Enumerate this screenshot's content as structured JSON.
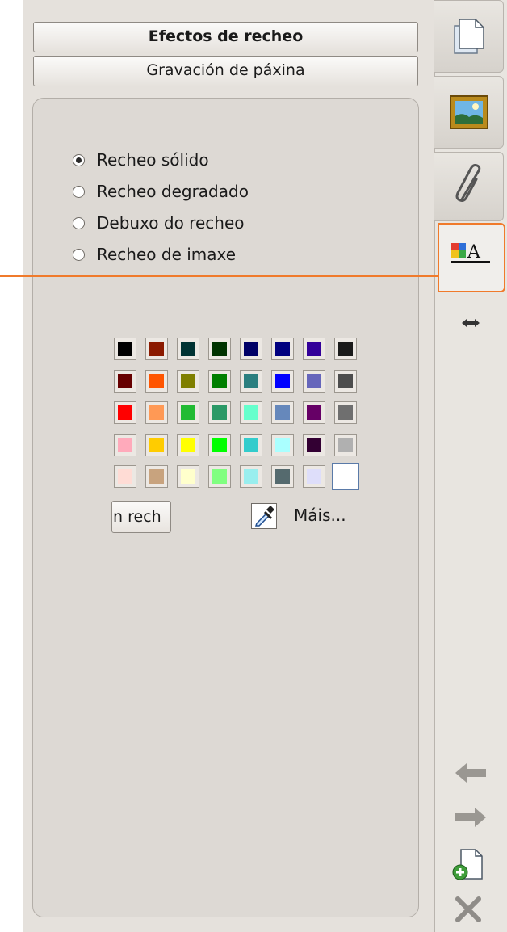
{
  "tabs_panel": {
    "title_button": "Efectos de recheo",
    "subtitle_button": "Gravación de páxina"
  },
  "fill_options": [
    {
      "label": "Recheo sólido",
      "checked": true
    },
    {
      "label": "Recheo degradado",
      "checked": false
    },
    {
      "label": "Debuxo do recheo",
      "checked": false
    },
    {
      "label": "Recheo de imaxe",
      "checked": false
    }
  ],
  "palette": {
    "rows": [
      [
        "#000000",
        "#8b1a00",
        "#003333",
        "#003300",
        "#000066",
        "#00007f",
        "#330099",
        "#1a1a1a"
      ],
      [
        "#660000",
        "#ff5500",
        "#7f7f00",
        "#007f00",
        "#2b7f7f",
        "#0000ff",
        "#6666bb",
        "#4d4d4d"
      ],
      [
        "#ff0000",
        "#ff9955",
        "#22bb33",
        "#2b9966",
        "#66ffcc",
        "#6688bb",
        "#660066",
        "#6f6f6f"
      ],
      [
        "#ffaabb",
        "#ffcc00",
        "#ffff00",
        "#00ff00",
        "#33cccc",
        "#aaffff",
        "#330033",
        "#b0b0b0"
      ],
      [
        "#ffdcd5",
        "#c8a37e",
        "#ffffcc",
        "#80ff80",
        "#99eeee",
        "#556a6e",
        "#dedefa",
        "#ffffff"
      ]
    ],
    "selected": "#ffffff"
  },
  "buttons": {
    "no_fill": "n rech",
    "more": "Máis..."
  },
  "sidebar": {
    "tabs": [
      {
        "name": "pages-tab",
        "icon": "pages-icon"
      },
      {
        "name": "gallery-tab",
        "icon": "picture-icon"
      },
      {
        "name": "attachments-tab",
        "icon": "paperclip-icon"
      },
      {
        "name": "properties-tab",
        "icon": "fill-properties-icon",
        "active": true
      }
    ],
    "resize_icon": "double-arrow-icon",
    "bottom_icons": [
      "back-arrow-icon",
      "forward-arrow-icon",
      "add-page-icon",
      "delete-icon"
    ]
  },
  "colors": {
    "highlight": "#f07a2b"
  }
}
